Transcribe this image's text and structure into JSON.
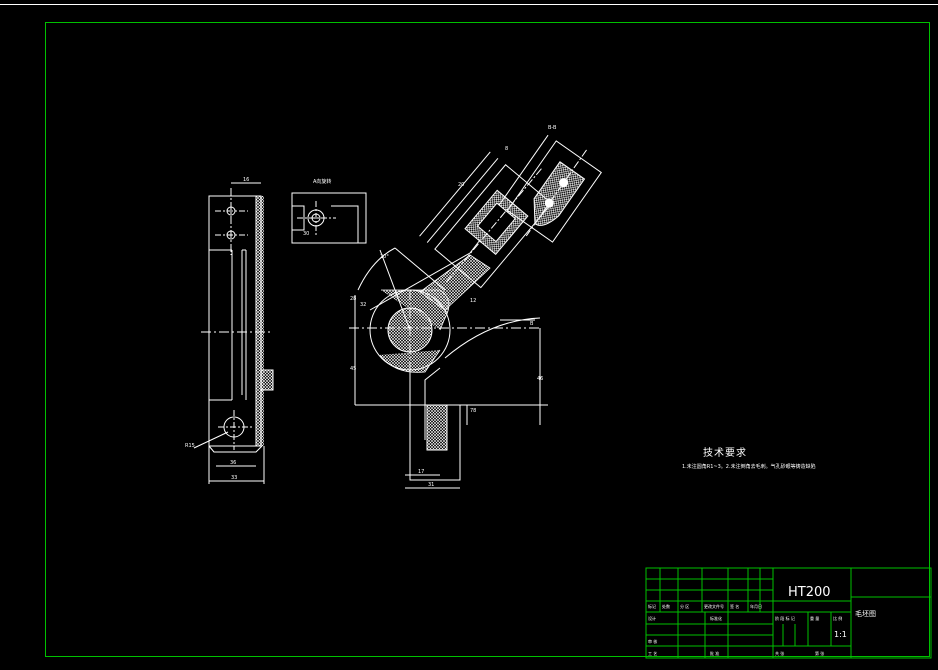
{
  "title_block": {
    "material": "HT200",
    "drawing_name": "毛坯图",
    "scale": "1:1",
    "cells": [
      "标记",
      "处数",
      "分 区",
      "更改文件号",
      "签 名",
      "年月日",
      "设计",
      "标准化",
      "阶 段 标 记",
      "重 量",
      "比 例",
      "审 核",
      "工 艺",
      "批 准",
      "共 张",
      "第 张"
    ]
  },
  "technical_requirements": {
    "title": "技术要求",
    "notes": "1.未注圆角R1~3。2.未注倒角去毛刺。气孔砂眼等铸造缺陷"
  },
  "view_labels": {
    "section_b": "B-B",
    "view_a": "A向旋转"
  },
  "dimensions": [
    "16",
    "33",
    "36",
    "R15",
    "30",
    "45",
    "46",
    "78",
    "28",
    "32",
    "17",
    "31",
    "20",
    "8",
    "12",
    "B",
    "20°"
  ],
  "colors": {
    "background": "#000000",
    "frame": "#00c000",
    "lines": "#ffffff",
    "hatch": "#ffffff",
    "center_lines": "#ffffff"
  }
}
